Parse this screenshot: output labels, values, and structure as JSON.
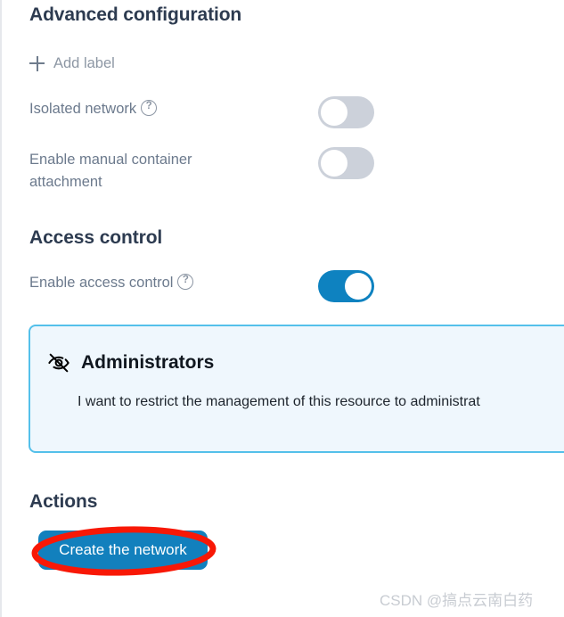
{
  "sections": {
    "advanced": {
      "title": "Advanced configuration",
      "add_label": {
        "icon": "plus-icon",
        "label": "Add label"
      },
      "fields": [
        {
          "label": "Isolated network",
          "help_icon": "question-mark-icon",
          "toggle_state": "off"
        },
        {
          "label": "Enable manual container attachment",
          "help_icon": "question-mark-icon",
          "toggle_state": "off"
        }
      ]
    },
    "access_control": {
      "title": "Access control",
      "field": {
        "label": "Enable access control",
        "help_icon": "question-mark-icon",
        "toggle_state": "on"
      },
      "info_box": {
        "icon": "eye-off-icon",
        "title": "Administrators",
        "body": "I want to restrict the management of this resource to administrat"
      }
    },
    "actions": {
      "title": "Actions",
      "create_button_label": "Create the network"
    }
  },
  "annotation": {
    "shape": "red-ellipse-highlight"
  },
  "watermark": "CSDN @搞点云南白药",
  "colors": {
    "heading": "#2d3b50",
    "label": "#6c7a8d",
    "toggle_on": "#0e82c0",
    "toggle_off": "#ccd1da",
    "info_box_bg": "#eff7fd",
    "info_box_border": "#54c0ea",
    "button_bg": "#1280bd",
    "annotation": "#f81806",
    "watermark": "#c8ccd2"
  }
}
